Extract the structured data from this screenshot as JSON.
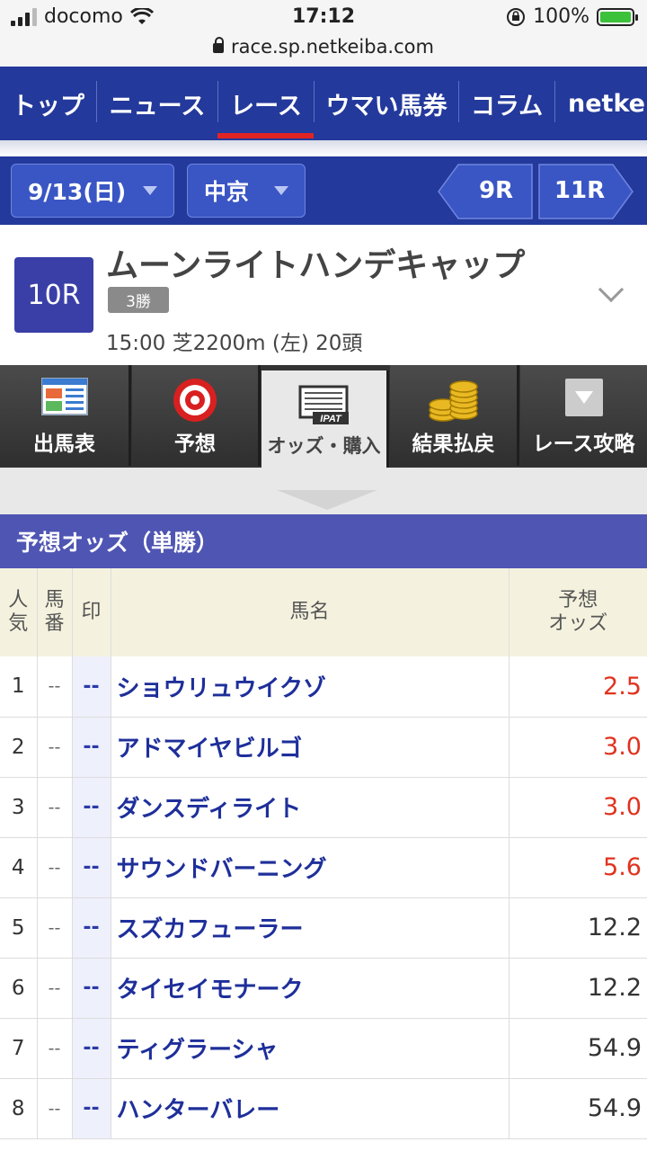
{
  "status": {
    "carrier": "docomo",
    "time": "17:12",
    "battery": "100%"
  },
  "url": "race.sp.netkeiba.com",
  "nav": {
    "items": [
      "トップ",
      "ニュース",
      "レース",
      "ウマい馬券",
      "コラム",
      "netkei"
    ],
    "active_index": 2
  },
  "selectors": {
    "date": "9/13(日)",
    "venue": "中京",
    "prev_race": "9R",
    "next_race": "11R"
  },
  "race": {
    "number": "10R",
    "name": "ムーンライトハンデキャップ",
    "class_badge": "3勝",
    "info": "15:00 芝2200m (左) 20頭"
  },
  "tabs": [
    "出馬表",
    "予想",
    "オッズ・購入",
    "結果払戻",
    "レース攻略"
  ],
  "tab_active_index": 2,
  "section_title": "予想オッズ（単勝）",
  "table": {
    "headers": {
      "popularity": [
        "人",
        "気"
      ],
      "horse_no": [
        "馬",
        "番"
      ],
      "mark": "印",
      "name": "馬名",
      "odds": [
        "予想",
        "オッズ"
      ]
    },
    "rows": [
      {
        "rank": "1",
        "no": "--",
        "mark": "--",
        "name": "ショウリュウイクゾ",
        "odds": "2.5",
        "hot": true
      },
      {
        "rank": "2",
        "no": "--",
        "mark": "--",
        "name": "アドマイヤビルゴ",
        "odds": "3.0",
        "hot": true
      },
      {
        "rank": "3",
        "no": "--",
        "mark": "--",
        "name": "ダンスディライト",
        "odds": "3.0",
        "hot": true
      },
      {
        "rank": "4",
        "no": "--",
        "mark": "--",
        "name": "サウンドバーニング",
        "odds": "5.6",
        "hot": true
      },
      {
        "rank": "5",
        "no": "--",
        "mark": "--",
        "name": "スズカフューラー",
        "odds": "12.2",
        "hot": false
      },
      {
        "rank": "6",
        "no": "--",
        "mark": "--",
        "name": "タイセイモナーク",
        "odds": "12.2",
        "hot": false
      },
      {
        "rank": "7",
        "no": "--",
        "mark": "--",
        "name": "ティグラーシャ",
        "odds": "54.9",
        "hot": false
      },
      {
        "rank": "8",
        "no": "--",
        "mark": "--",
        "name": "ハンターバレー",
        "odds": "54.9",
        "hot": false
      }
    ]
  },
  "colors": {
    "brand_blue": "#23399b",
    "active_red": "#e02424",
    "hot_odds": "#e0321e"
  }
}
